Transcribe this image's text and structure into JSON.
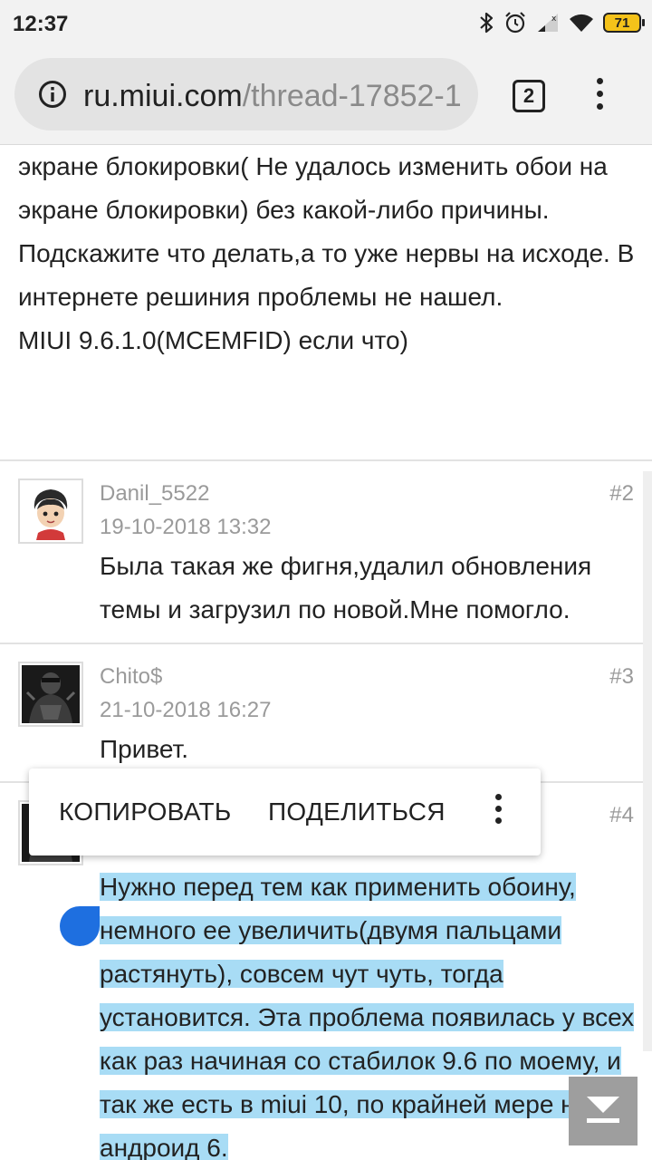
{
  "status_bar": {
    "time": "12:37",
    "battery": "71"
  },
  "browser": {
    "url_host": "ru.miui.com",
    "url_path": "/thread-17852-1",
    "tab_count": "2"
  },
  "thread": {
    "op_lines": [
      "экране блокировки( Не удалось изменить обои на экране блокировки) без какой-либо причины.",
      "Подскажите что делать,а то уже нервы на исходе. В интернете решиния проблемы не нашел.",
      "MIUI 9.6.1.0(MCEMFID) если что)"
    ],
    "posts": [
      {
        "author": "Danil_5522",
        "date": "19-10-2018 13:32",
        "number": "#2",
        "text": "Была такая же фигня,удалил обновления темы и загрузил по новой.Мне помогло."
      },
      {
        "author": "Chito$",
        "date": "21-10-2018 16:27",
        "number": "#3",
        "text": "Привет."
      },
      {
        "author": "",
        "date": "",
        "number": "#4",
        "text": "Нужно перед тем как применить обоину, немного ее увеличить(двумя пальцами растянуть), совсем чут чуть, тогда установится. Эта проблема появилась у всех как раз начиная со стабилок 9.6 по моему, и так же есть в miui 10, по крайней мере на андроид 6."
      }
    ]
  },
  "context_menu": {
    "copy_label": "КОПИРОВАТЬ",
    "share_label": "ПОДЕЛИТЬСЯ"
  },
  "colors": {
    "selection": "#a8dcf5",
    "selection_handle": "#1e6fe0",
    "meta_text": "#9a9a9a"
  },
  "icons": {
    "info": "info-icon",
    "menu": "more-vert-icon",
    "scroll_down": "scroll-down-icon"
  }
}
